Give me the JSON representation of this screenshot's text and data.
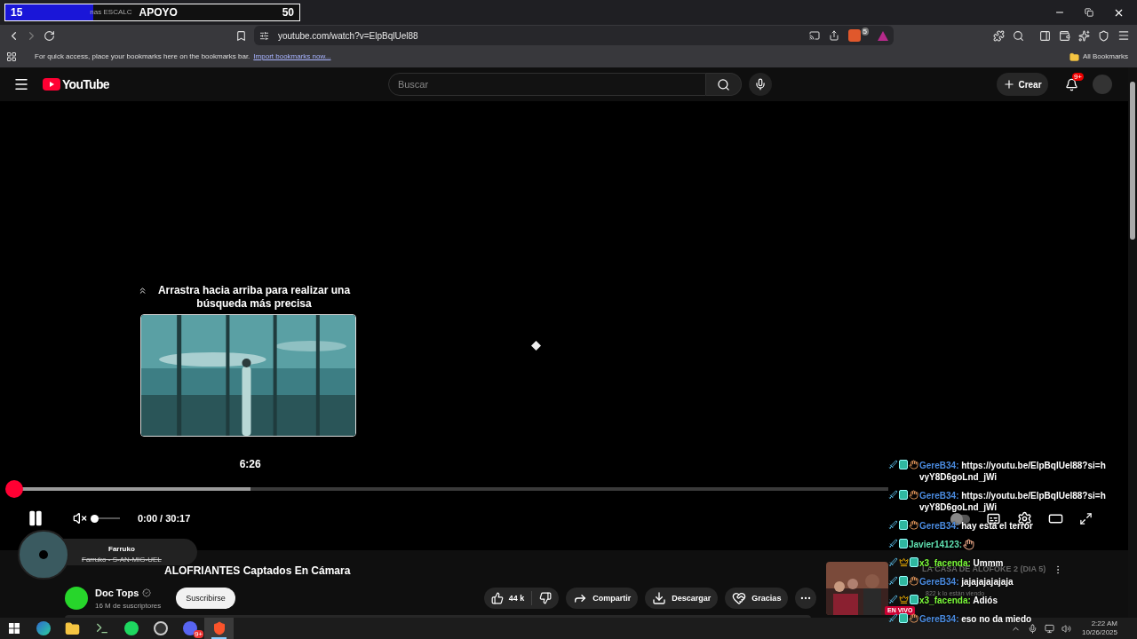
{
  "goal_bar": {
    "current": "15",
    "ticker": "nas ESCALC",
    "label": "APOYO",
    "target": "50",
    "level": 0.3
  },
  "browser": {
    "url": "youtube.com/watch?v=ElpBqlUel88",
    "extension_badge": "5",
    "bookmarks_hint": "For quick access, place your bookmarks here on the bookmarks bar.",
    "import_link": "Import bookmarks now...",
    "all_bookmarks": "All Bookmarks"
  },
  "youtube": {
    "logo": "YouTube",
    "search_placeholder": "Buscar",
    "create": "Crear",
    "notifications": "9+"
  },
  "player": {
    "hint": "Arrastra hacia arriba para realizar una búsqueda más precisa",
    "preview": {
      "time": "6:26",
      "level": 0.27
    },
    "progress": {
      "level": 0
    },
    "playing": true,
    "volume": {
      "muted": true,
      "level": 0
    },
    "time": "0:00 / 30:17",
    "autoplay": {
      "on": false
    }
  },
  "music_widget": {
    "title": "Farruko",
    "subtitle": "Farruko - S-AN-MIG-UEL"
  },
  "video": {
    "title": "ALOFRIANTES Captados En Cámara",
    "channel": "Doc Tops",
    "verified": true,
    "subscribers": "16 M de suscriptores",
    "subscribe": "Suscribirse",
    "likes": "44 k",
    "actions": [
      {
        "kind": "share",
        "label": "Compartir"
      },
      {
        "kind": "download",
        "label": "Descargar"
      },
      {
        "kind": "thanks",
        "label": "Gracias"
      }
    ]
  },
  "live_card": {
    "title": "LA CASA DE ALOFOKE 2 (DIA 5)",
    "viewers": "822 k lo están viendo",
    "badge": "EN VIVO"
  },
  "chat": [
    {
      "kind": "hand",
      "user": "GereB34:",
      "color": "#4a8be0",
      "text": "https://youtu.be/ElpBqlUel88?si=hvyY8D6goLnd_jWi"
    },
    {
      "kind": "hand",
      "user": "GereB34:",
      "color": "#4a8be0",
      "text": "https://youtu.be/ElpBqlUel88?si=hvyY8D6goLnd_jWi"
    },
    {
      "kind": "hand",
      "user": "GereB34:",
      "color": "#4a8be0",
      "text": "hay está el terror"
    },
    {
      "kind": "emote",
      "user": "Javier14123:",
      "color": "#5fe0b0"
    },
    {
      "kind": "crown",
      "user": "x3_facenda:",
      "color": "#7cfc3a",
      "text": "Ummm"
    },
    {
      "kind": "hand",
      "user": "GereB34:",
      "color": "#4a8be0",
      "text": "jajajajajajaja"
    },
    {
      "kind": "crown",
      "user": "x3_facenda:",
      "color": "#7cfc3a",
      "text": "Adiós"
    },
    {
      "kind": "hand",
      "user": "GereB34:",
      "color": "#4a8be0",
      "text": "eso no da miedo"
    }
  ],
  "taskbar": {
    "apps": [
      {
        "kind": "edge",
        "selected": false
      },
      {
        "kind": "files",
        "selected": false
      },
      {
        "kind": "terminal",
        "selected": false
      },
      {
        "kind": "spotify",
        "selected": false
      },
      {
        "kind": "obs",
        "selected": false
      },
      {
        "kind": "discord",
        "selected": false,
        "badge": "9+"
      },
      {
        "kind": "brave",
        "selected": true
      }
    ],
    "time": "2:22 AM",
    "date": "10/26/2025"
  }
}
